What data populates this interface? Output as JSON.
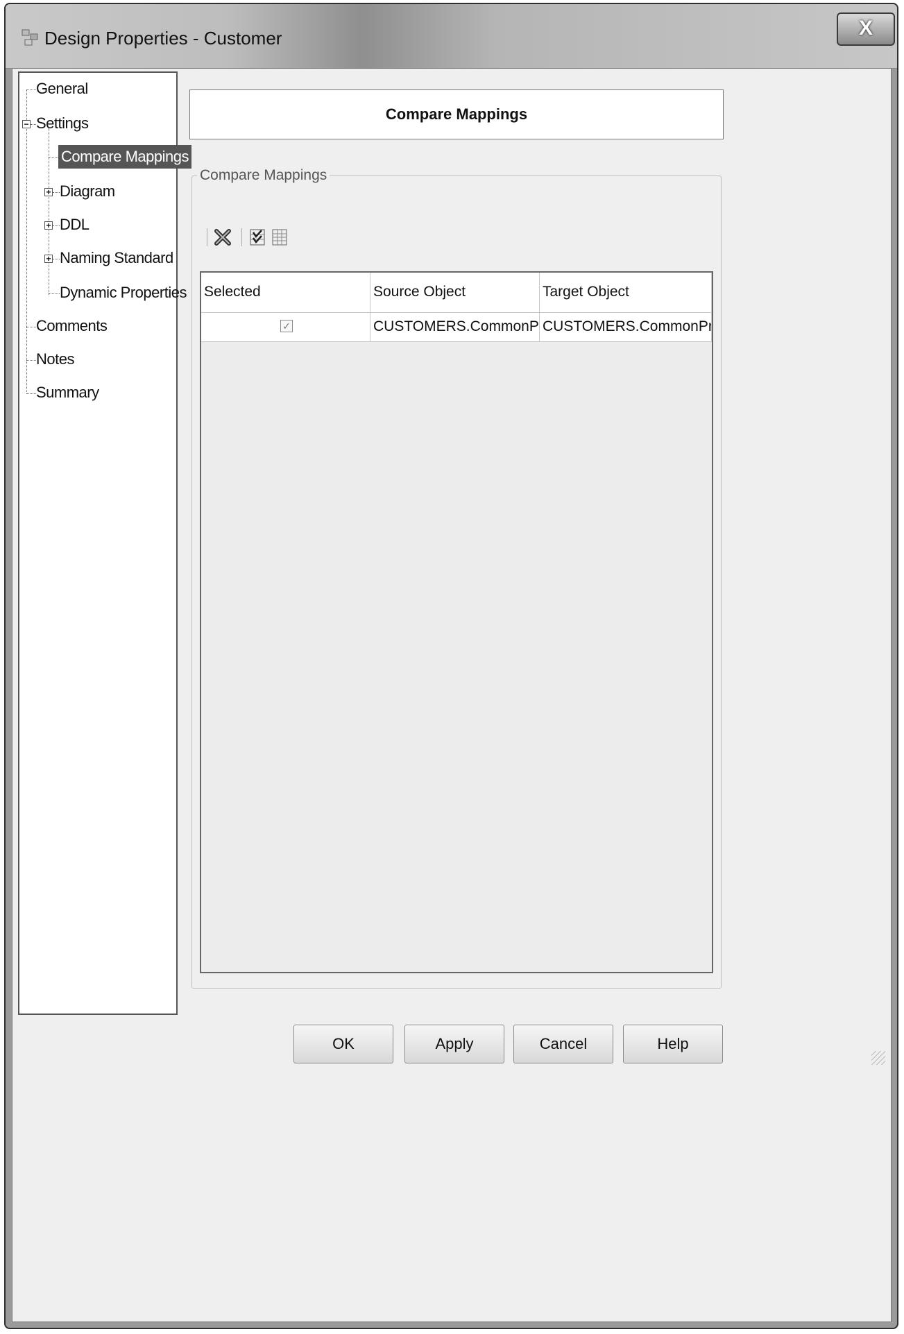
{
  "window": {
    "title": "Design Properties - Customer",
    "close_label": "X"
  },
  "tree": {
    "items": [
      {
        "label": "General"
      },
      {
        "label": "Settings",
        "expander": "−"
      },
      {
        "label": "Compare Mappings",
        "selected": true
      },
      {
        "label": "Diagram",
        "expander": "+"
      },
      {
        "label": "DDL",
        "expander": "+"
      },
      {
        "label": "Naming Standard",
        "expander": "+"
      },
      {
        "label": "Dynamic Properties"
      },
      {
        "label": "Comments"
      },
      {
        "label": "Notes"
      },
      {
        "label": "Summary"
      }
    ]
  },
  "panel": {
    "header": "Compare Mappings",
    "group_label": "Compare Mappings",
    "toolbar_icons": [
      "delete-icon",
      "check-all-icon",
      "grid-icon"
    ]
  },
  "grid": {
    "columns": [
      "Selected",
      "Source Object",
      "Target Object"
    ],
    "rows": [
      {
        "selected": true,
        "source": "CUSTOMERS.CommonProperty",
        "target": "CUSTOMERS.CommonProp"
      }
    ]
  },
  "buttons": {
    "ok": "OK",
    "apply": "Apply",
    "cancel": "Cancel",
    "help": "Help"
  },
  "colors": {
    "selection": "#555555",
    "titlebar": "#bdbdbd"
  }
}
